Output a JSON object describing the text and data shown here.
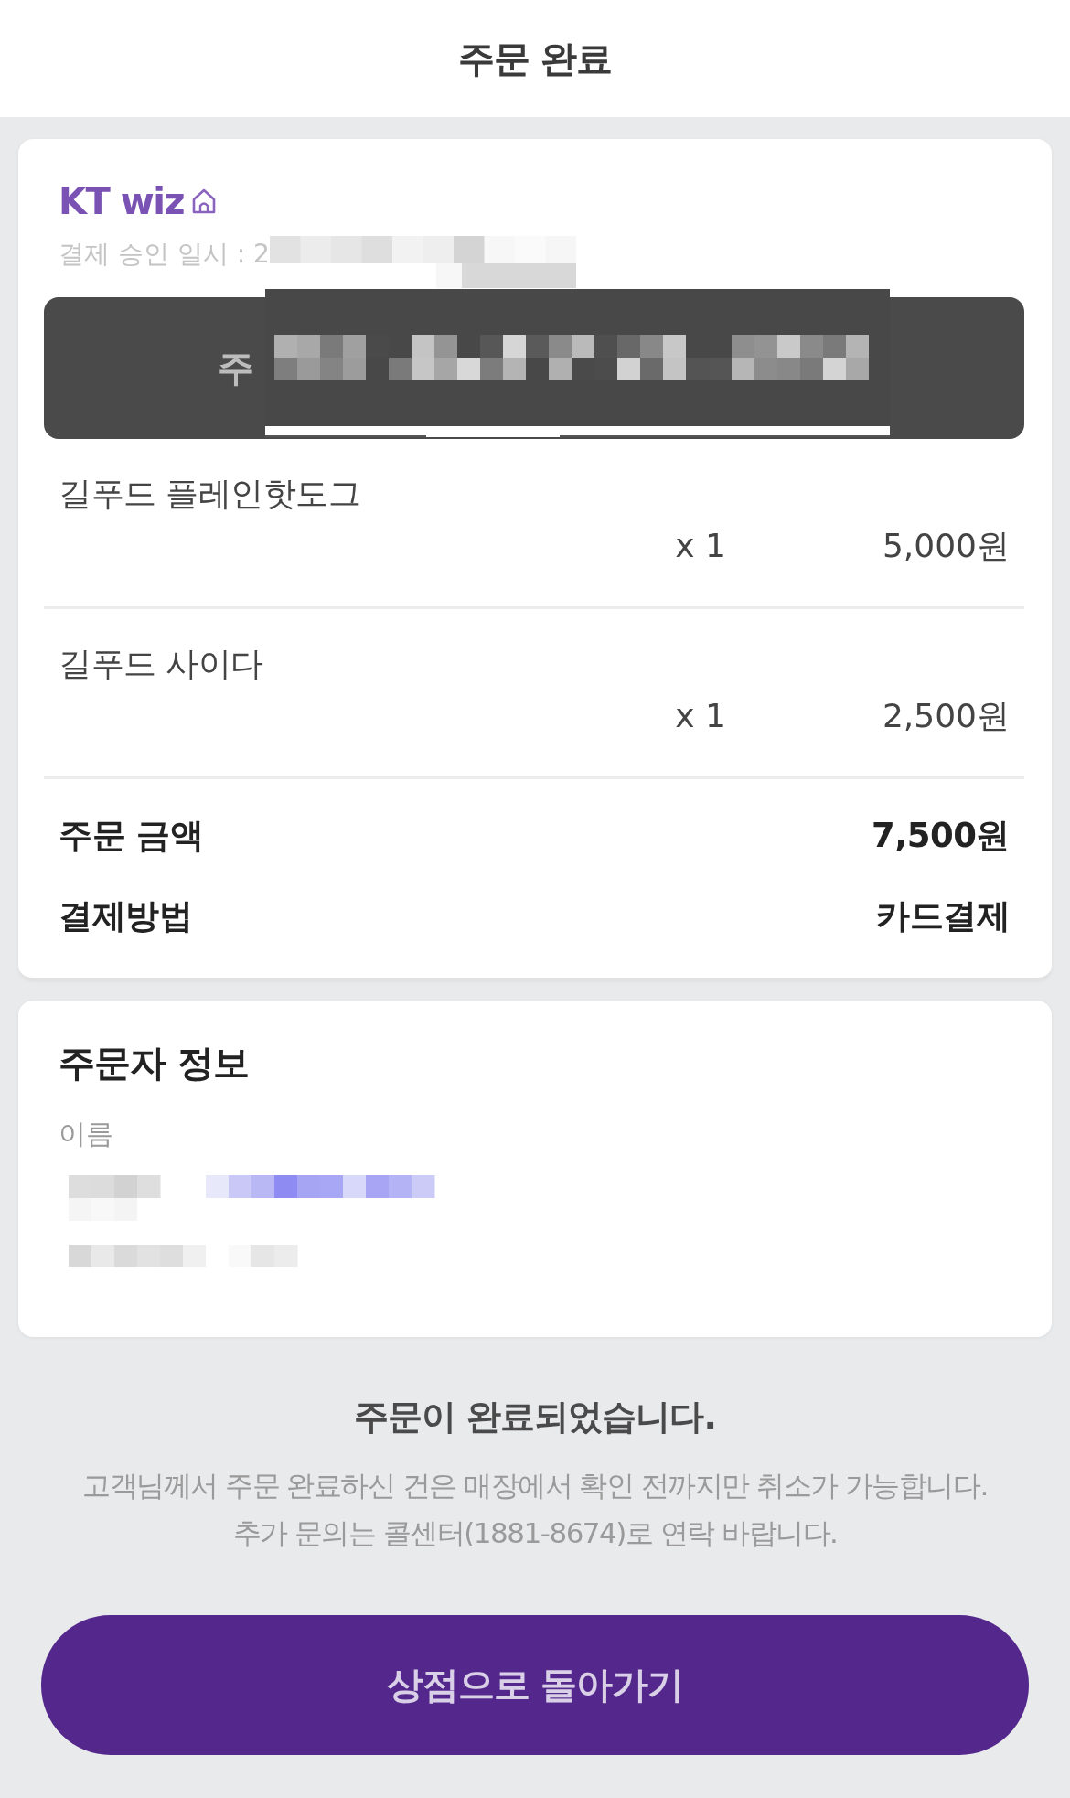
{
  "header": {
    "title": "주문 완료"
  },
  "order_card": {
    "store_name": "KT wiz",
    "approval_time": "결제 승인 일시 : 2",
    "order_number_banner": "주",
    "items": [
      {
        "name": "길푸드 플레인핫도그",
        "quantity": "x 1",
        "price": "5,000원"
      },
      {
        "name": "길푸드 사이다",
        "quantity": "x 1",
        "price": "2,500원"
      }
    ],
    "summary": [
      {
        "label": "주문 금액",
        "value": "7,500원"
      },
      {
        "label": "결제방법",
        "value": "카드결제"
      }
    ]
  },
  "orderer_info": {
    "title": "주문자 정보",
    "fields": [
      {
        "label": "이름"
      }
    ]
  },
  "completion": {
    "title": "주문이 완료되었습니다.",
    "lines": [
      "고객님께서 주문 완료하신 건은 매장에서 확인 전까지만 취소가 가능합니다.",
      "추가 문의는 콜센터(1881-8674)로 연락 바랍니다."
    ]
  },
  "button": {
    "label": "상점으로 돌아가기"
  }
}
